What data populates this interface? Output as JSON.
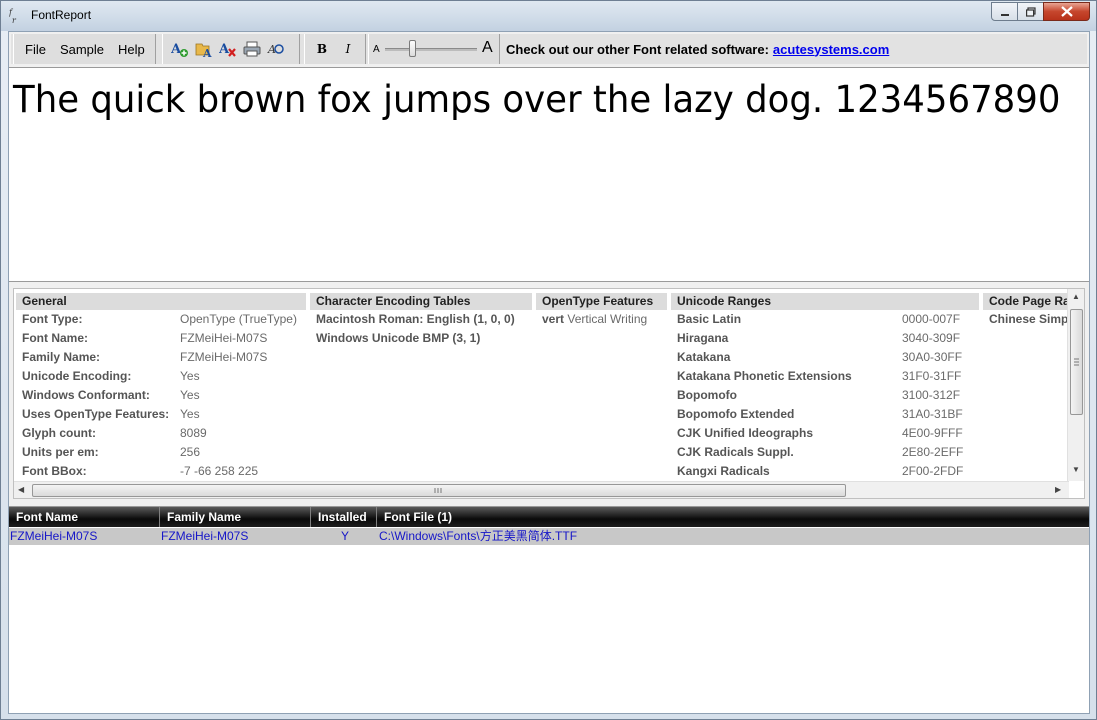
{
  "window": {
    "title": "FontReport",
    "app_icon": "fr"
  },
  "menu": [
    "File",
    "Sample",
    "Help"
  ],
  "toolbar": {
    "icons": [
      "add-font-icon",
      "open-font-folder-icon",
      "remove-font-icon",
      "print-icon",
      "preview-icon"
    ],
    "bold_label": "B",
    "italic_label": "I",
    "size_small_label": "A",
    "size_large_label": "A",
    "promo_text": "Check out our other Font related software:",
    "promo_link": "acutesystems.com"
  },
  "sample_text": "The quick brown fox jumps over the lazy dog. 1234567890",
  "general": {
    "heading": "General",
    "rows": [
      {
        "label": "Font Type:",
        "value": "OpenType (TrueType)"
      },
      {
        "label": "Font Name:",
        "value": "FZMeiHei-M07S"
      },
      {
        "label": "Family Name:",
        "value": "FZMeiHei-M07S"
      },
      {
        "label": "Unicode Encoding:",
        "value": "Yes"
      },
      {
        "label": "Windows Conformant:",
        "value": "Yes"
      },
      {
        "label": "Uses OpenType Features:",
        "value": "Yes"
      },
      {
        "label": "Glyph count:",
        "value": "8089"
      },
      {
        "label": "Units per em:",
        "value": "256"
      },
      {
        "label": "Font BBox:",
        "value": "-7 -66 258 225"
      }
    ]
  },
  "encoding": {
    "heading": "Character Encoding Tables",
    "rows": [
      "Macintosh Roman: English (1, 0, 0)",
      "Windows Unicode BMP (3, 1)"
    ]
  },
  "opentype": {
    "heading": "OpenType Features",
    "rows": [
      {
        "tag": "vert",
        "desc": "Vertical Writing"
      }
    ]
  },
  "unicode": {
    "heading": "Unicode Ranges",
    "rows": [
      {
        "name": "Basic Latin",
        "range": "0000-007F"
      },
      {
        "name": "Hiragana",
        "range": "3040-309F"
      },
      {
        "name": "Katakana",
        "range": "30A0-30FF"
      },
      {
        "name": "Katakana Phonetic Extensions",
        "range": "31F0-31FF"
      },
      {
        "name": "Bopomofo",
        "range": "3100-312F"
      },
      {
        "name": "Bopomofo Extended",
        "range": "31A0-31BF"
      },
      {
        "name": "CJK Unified Ideographs",
        "range": "4E00-9FFF"
      },
      {
        "name": "CJK Radicals Suppl.",
        "range": "2E80-2EFF"
      },
      {
        "name": "Kangxi Radicals",
        "range": "2F00-2FDF"
      }
    ]
  },
  "codepage": {
    "heading": "Code Page Ra",
    "rows": [
      "Chinese Simp"
    ]
  },
  "list": {
    "columns": [
      "Font Name",
      "Family Name",
      "Installed",
      "Font File (1)"
    ],
    "rows": [
      [
        "FZMeiHei-M07S",
        "FZMeiHei-M07S",
        "Y",
        "C:\\Windows\\Fonts\\方正美黑简体.TTF"
      ]
    ]
  }
}
